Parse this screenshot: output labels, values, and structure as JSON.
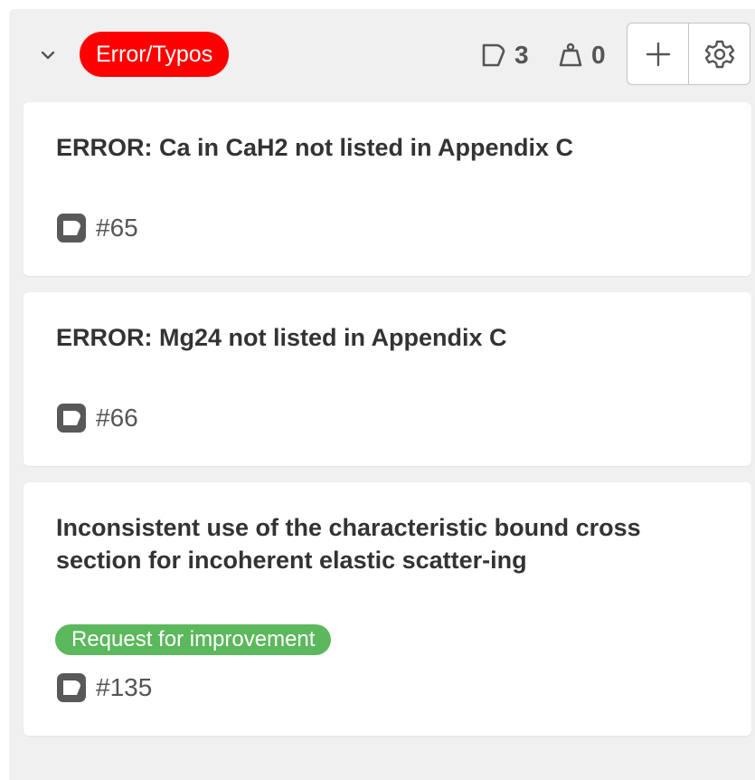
{
  "column": {
    "label": "Error/Typos",
    "label_color": "#ff0000",
    "issue_count": "3",
    "weight_count": "0",
    "icons": {
      "collapse": "chevron-down-icon",
      "issues": "issues-icon",
      "weight": "weight-icon",
      "add": "plus-icon",
      "settings": "gear-icon"
    }
  },
  "cards": [
    {
      "title": "ERROR: Ca in CaH2 not listed in Appendix C",
      "reference": "#65",
      "icon": "issue-open-icon"
    },
    {
      "title": "ERROR: Mg24 not listed in Appendix C",
      "reference": "#66",
      "icon": "issue-open-icon"
    },
    {
      "title": "Inconsistent use of the characteristic bound cross section for incoherent elastic scatter-ing",
      "tag": "Request for improvement",
      "tag_color": "#5cb85c",
      "reference": "#135",
      "icon": "issue-open-icon"
    }
  ]
}
